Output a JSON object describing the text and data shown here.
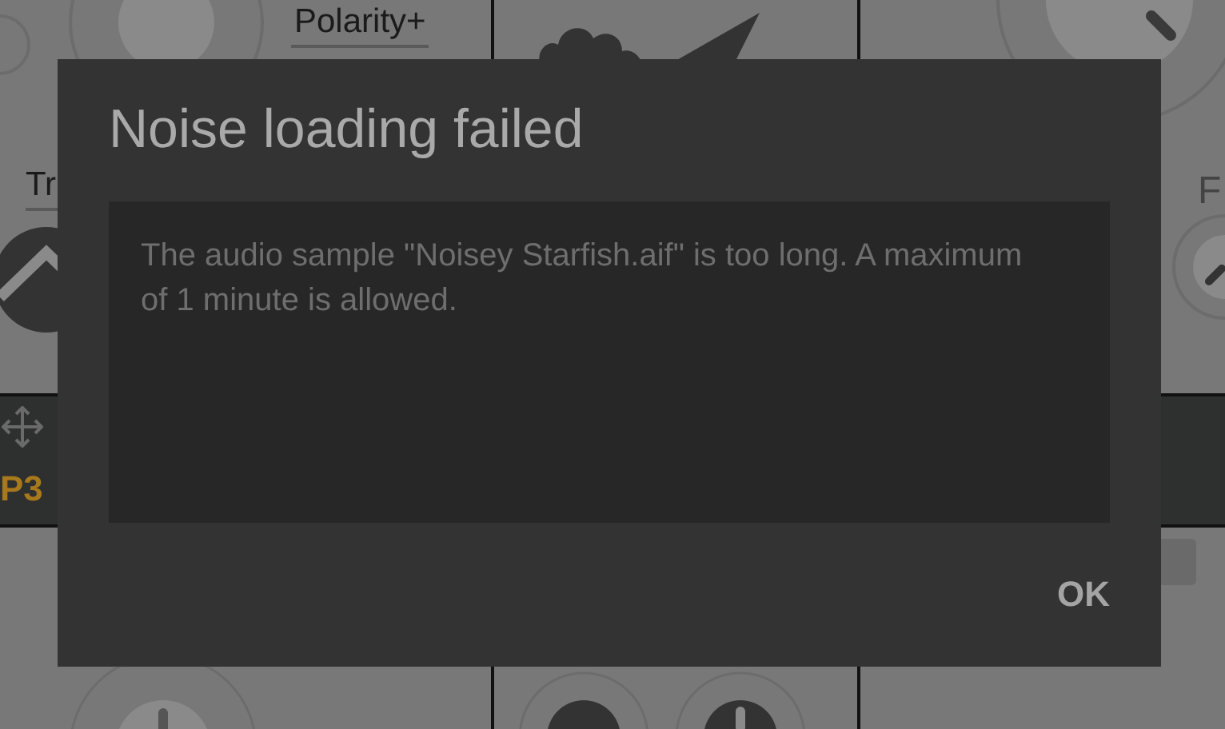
{
  "background": {
    "top_label": "Polarity+",
    "left_label": "Tr",
    "right_label": "F",
    "slot_label": "P3"
  },
  "dialog": {
    "title": "Noise loading failed",
    "message": "The audio sample \"Noisey Starfish.aif\" is too long. A maximum of 1 minute is allowed.",
    "buttons": [
      "OK"
    ]
  }
}
